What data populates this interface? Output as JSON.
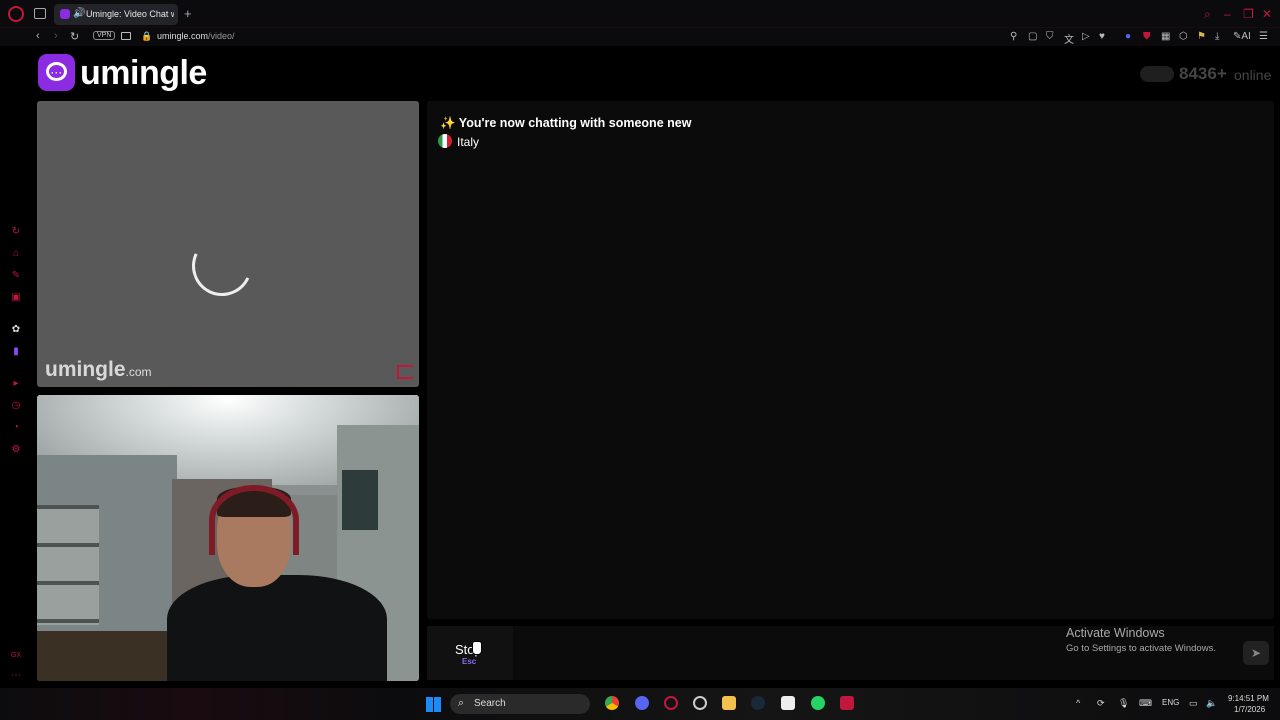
{
  "browser": {
    "tab_title": "Umingle: Video Chat w",
    "new_tab": "+",
    "url_host": "umingle.com",
    "url_path": "/video/",
    "vpn_label": "VPN",
    "ai_label": "AI",
    "accent_color": "#c2173d"
  },
  "site": {
    "logo_text": "umingle",
    "brand_color": "#8b2be2",
    "online_count": "8436+",
    "online_label": "online"
  },
  "stranger_video": {
    "watermark": "umingle",
    "watermark_domain": ".com"
  },
  "chat": {
    "header": "✨ You're now chatting with someone new",
    "country": "Italy"
  },
  "controls": {
    "stop_label": "Stop",
    "stop_shortcut": "Esc",
    "message_placeholder": "",
    "send_icon": "send-icon"
  },
  "os": {
    "activate_title": "Activate Windows",
    "activate_sub": "Go to Settings to activate Windows.",
    "search_label": "Search",
    "language": "ENG",
    "time": "9:14:51 PM",
    "date": "1/7/2026"
  }
}
